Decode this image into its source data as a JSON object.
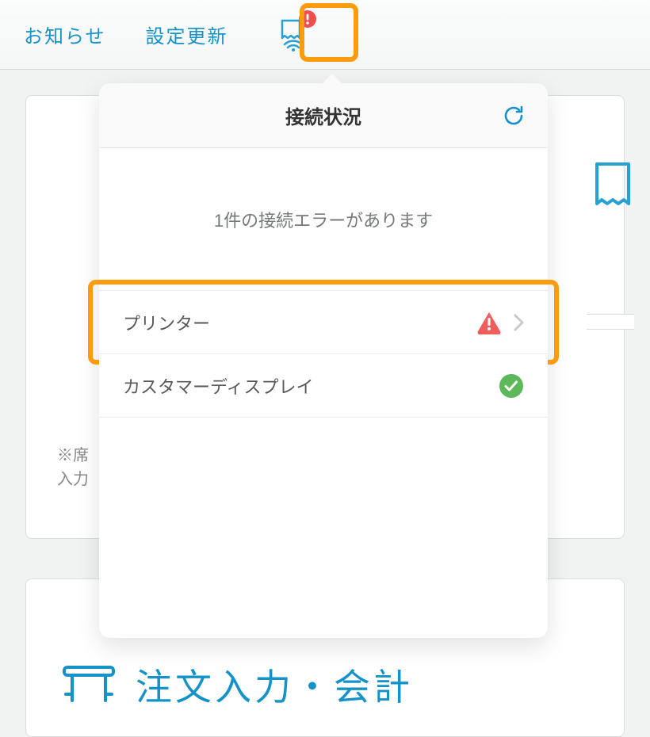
{
  "topbar": {
    "notice_label": "お知らせ",
    "settings_update_label": "設定更新"
  },
  "popover": {
    "title": "接続状況",
    "error_message": "1件の接続エラーがあります",
    "items": [
      {
        "label": "プリンター",
        "status": "error"
      },
      {
        "label": "カスタマーディスプレイ",
        "status": "ok"
      }
    ]
  },
  "background": {
    "note_l1": "※席",
    "note_l2": "入力",
    "big_title": "注文入力・会計"
  }
}
